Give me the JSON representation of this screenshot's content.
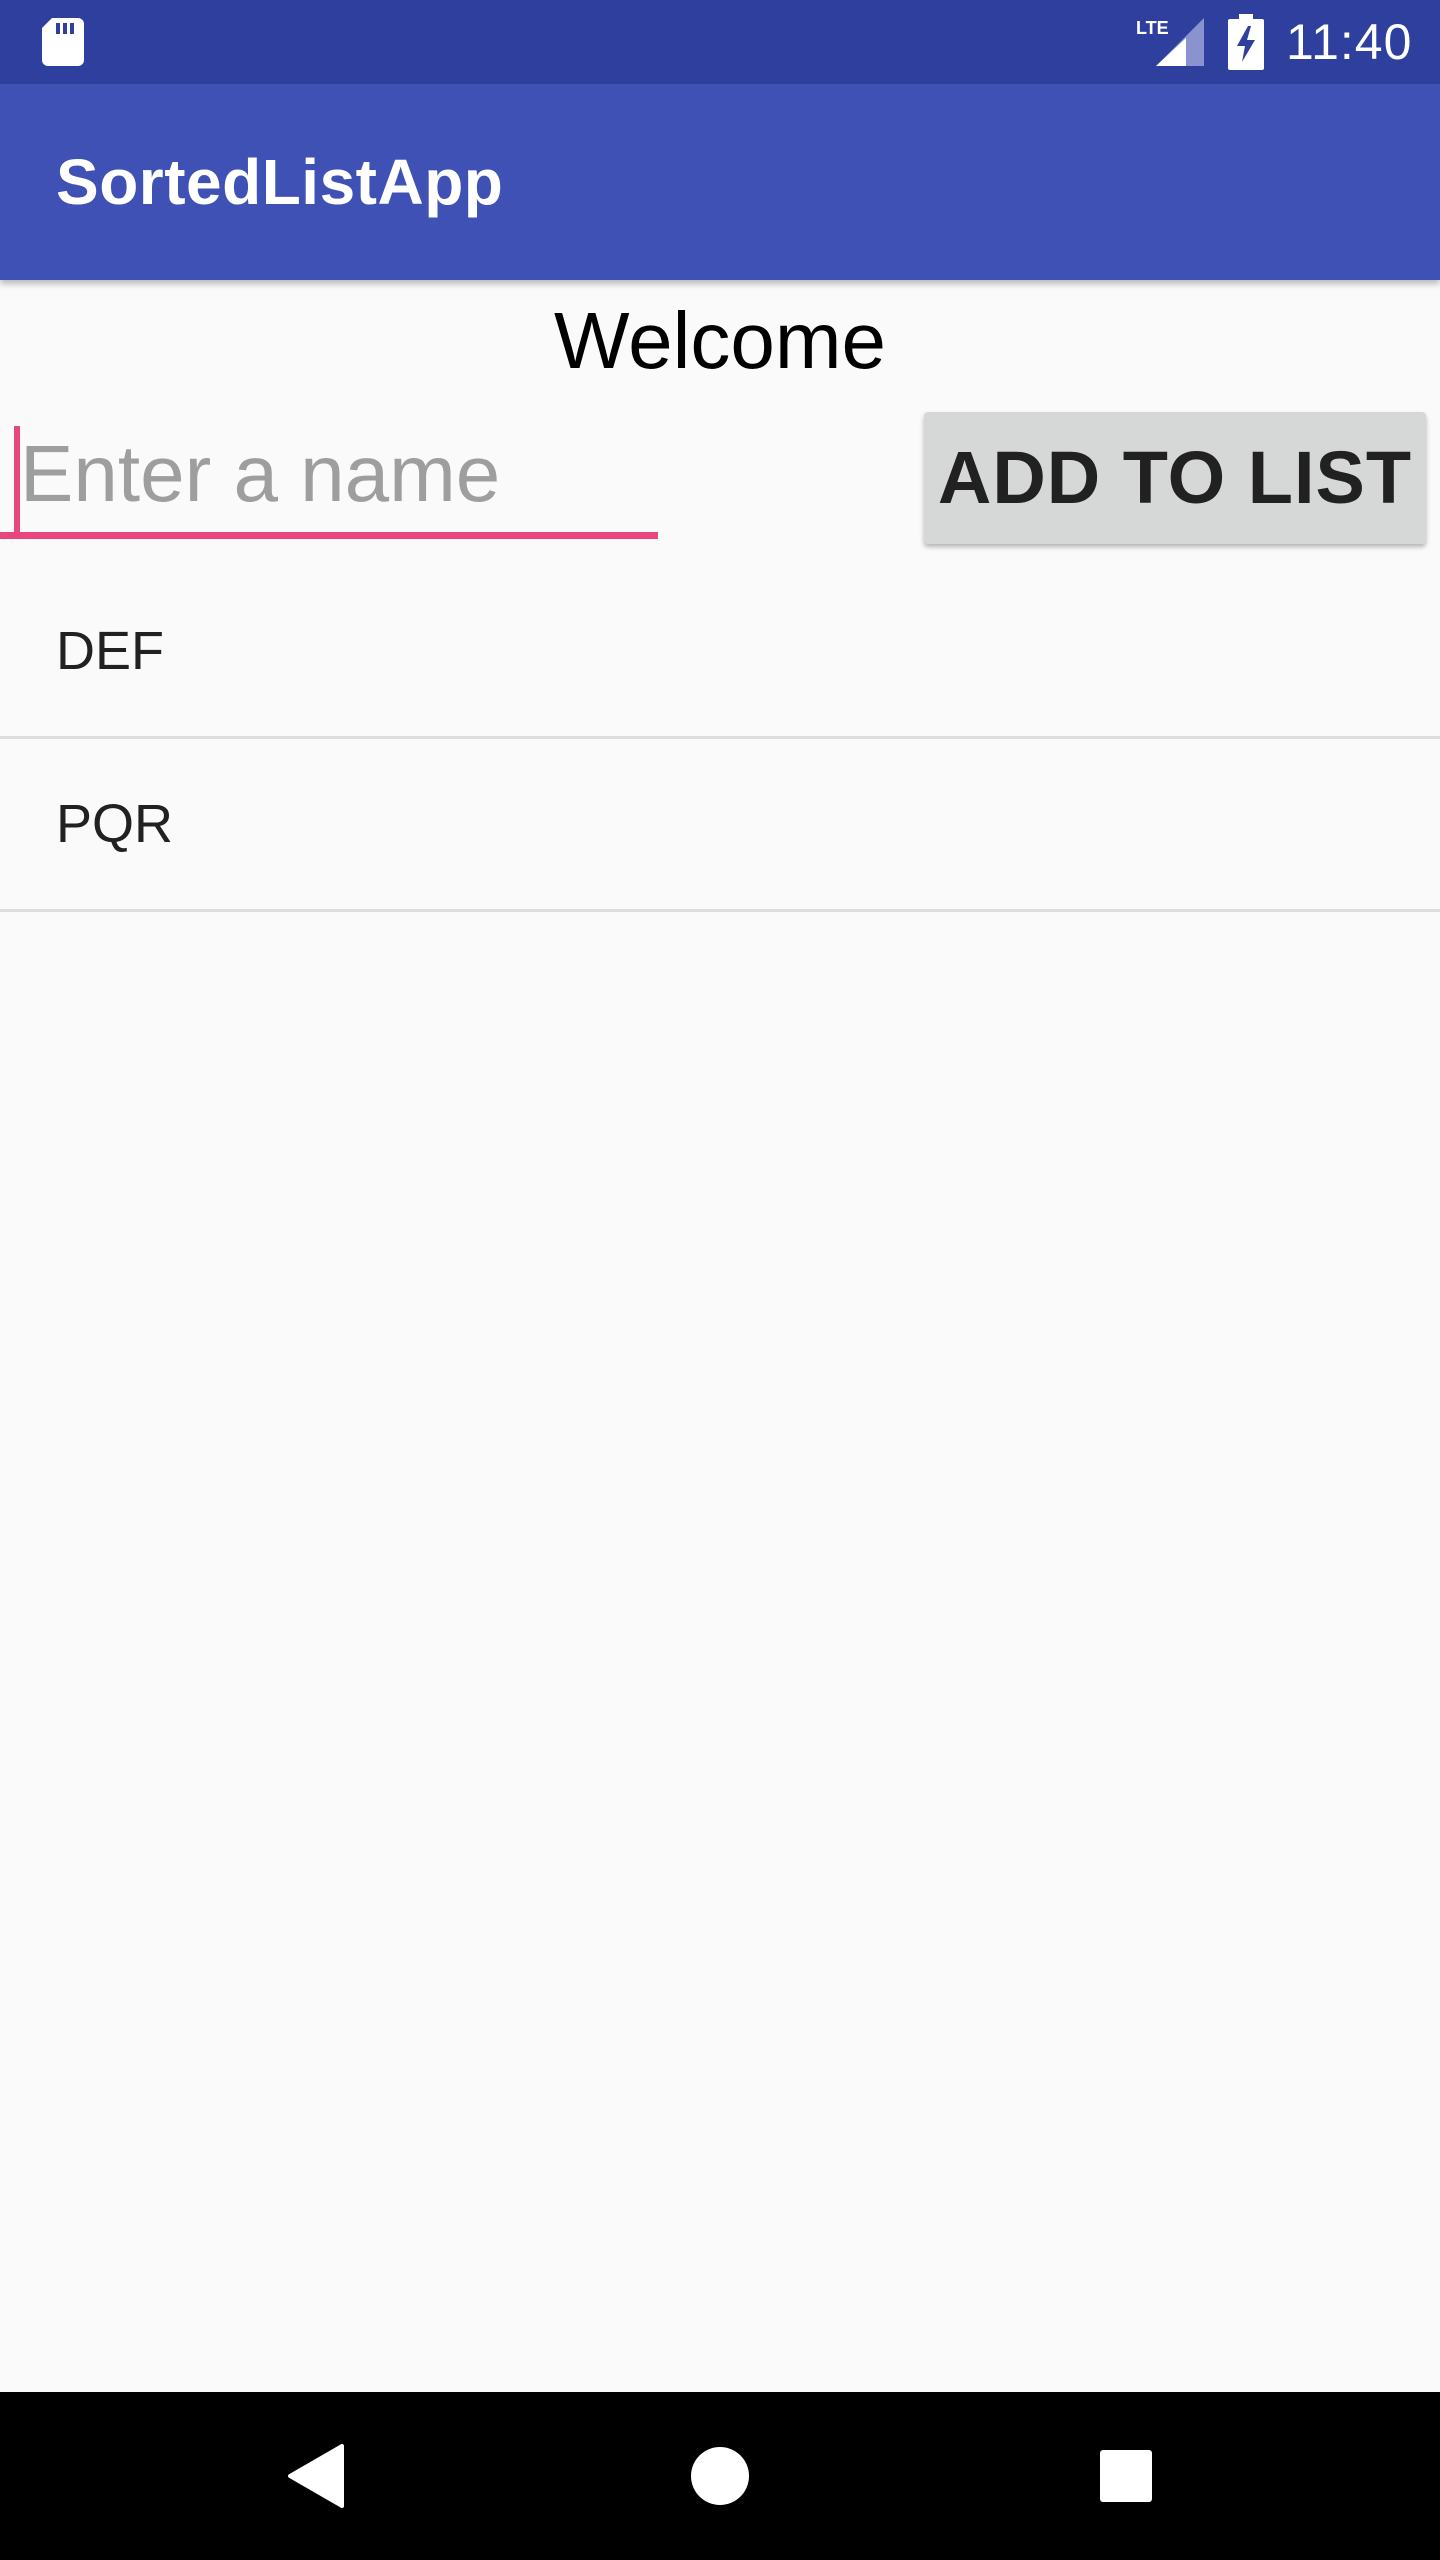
{
  "status_bar": {
    "time": "11:40",
    "icons": [
      "sd-card-icon",
      "lte-signal-icon",
      "battery-charging-icon"
    ],
    "network_label": "LTE"
  },
  "app_bar": {
    "title": "SortedListApp",
    "color": "#3f51b5"
  },
  "main": {
    "heading": "Welcome",
    "input": {
      "value": "",
      "placeholder": "Enter a name"
    },
    "add_button_label": "ADD TO LIST",
    "list_items": [
      {
        "label": "DEF"
      },
      {
        "label": "PQR"
      }
    ]
  },
  "nav_bar": {
    "icons": [
      "back-icon",
      "home-icon",
      "recents-icon"
    ]
  },
  "colors": {
    "status_bar": "#2f3f9e",
    "accent": "#e8467c",
    "background": "#fafafa"
  }
}
